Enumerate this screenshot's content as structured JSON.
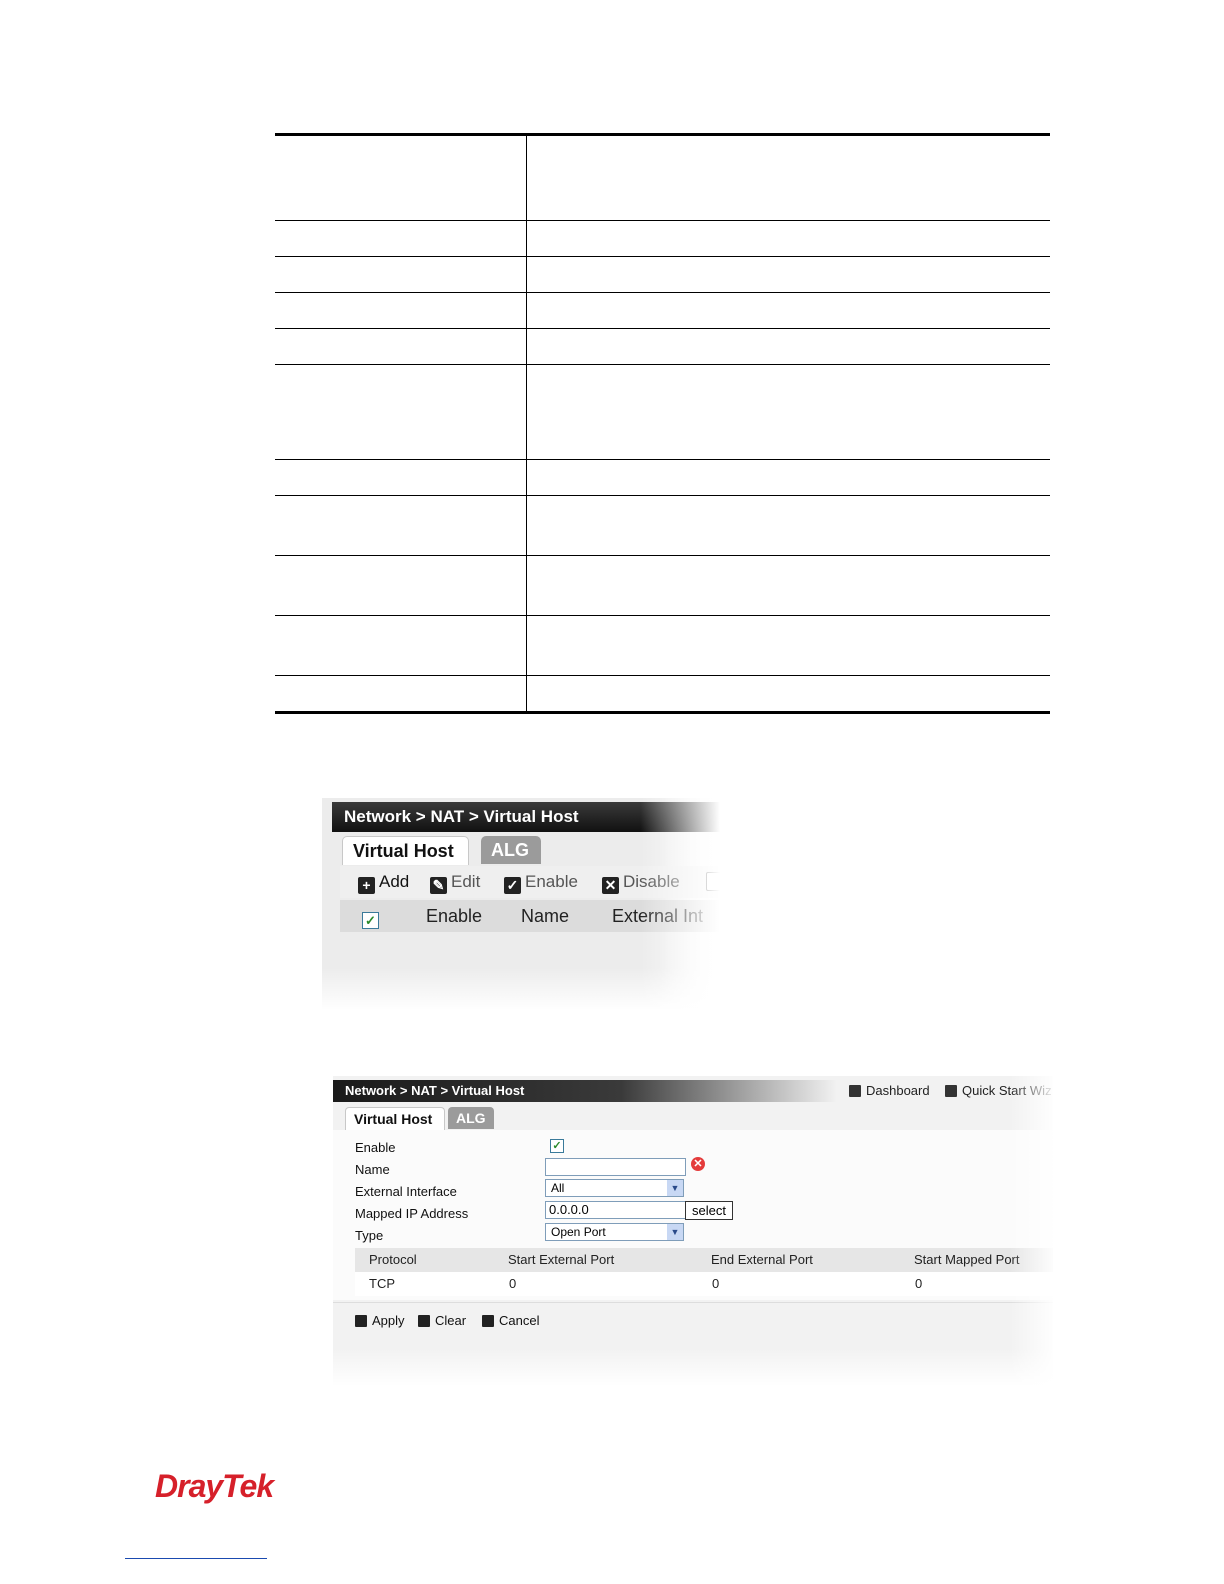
{
  "shot1": {
    "title": "Network > NAT > Virtual Host",
    "tabs": [
      "Virtual Host",
      "ALG"
    ],
    "toolbar": [
      "Add",
      "Edit",
      "Enable",
      "Disable"
    ],
    "columns": [
      "Enable",
      "Name",
      "External Int"
    ]
  },
  "shot2": {
    "title": "Network > NAT > Virtual Host",
    "links": [
      "Dashboard",
      "Quick Start Wiz"
    ],
    "tabs": [
      "Virtual Host",
      "ALG"
    ],
    "form": {
      "labels": [
        "Enable",
        "Name",
        "External Interface",
        "Mapped IP Address",
        "Type"
      ],
      "name_value": "",
      "external_interface": "All",
      "mapped_ip": "0.0.0.0",
      "select_button": "select",
      "type": "Open Port"
    },
    "table": {
      "headers": [
        "Protocol",
        "Start External Port",
        "End External Port",
        "Start Mapped Port"
      ],
      "row": [
        "TCP",
        "0",
        "0",
        "0"
      ]
    },
    "actions": [
      "Apply",
      "Clear",
      "Cancel"
    ]
  },
  "logo": "DrayTek",
  "colors": {
    "brand_red": "#d6202a",
    "title_bar": "#1a1a1a",
    "tab_inactive": "#9b9b9b"
  }
}
